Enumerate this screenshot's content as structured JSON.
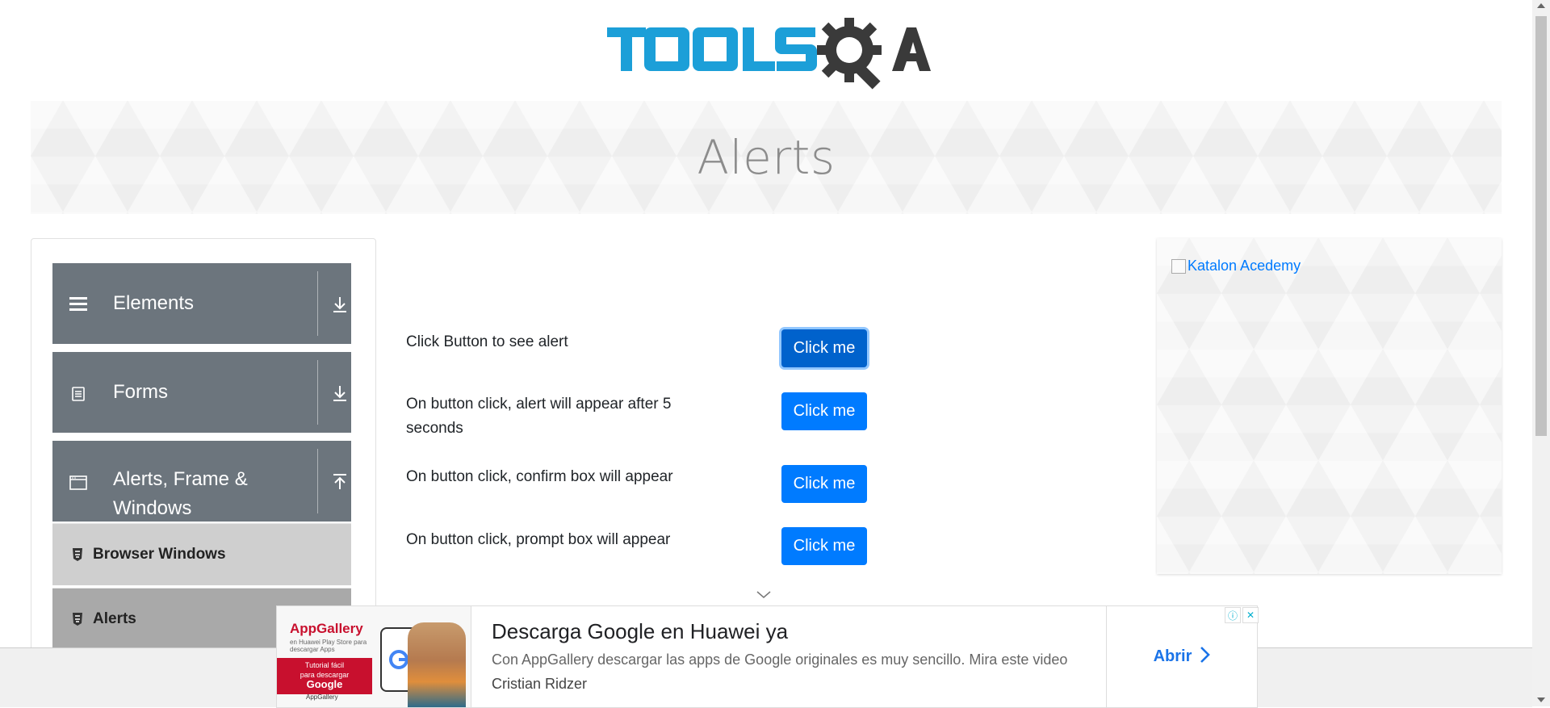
{
  "header": {
    "logo_text": "TOOLSQA"
  },
  "banner": {
    "title": "Alerts"
  },
  "sidebar": {
    "groups": [
      {
        "label": "Elements",
        "icon": "hamburger-icon",
        "state": "collapsed"
      },
      {
        "label": "Forms",
        "icon": "document-icon",
        "state": "collapsed"
      },
      {
        "label": "Alerts, Frame & Windows",
        "icon": "window-icon",
        "state": "expanded"
      }
    ],
    "items": [
      {
        "label": "Browser Windows",
        "icon": "html5-icon",
        "active": false
      },
      {
        "label": "Alerts",
        "icon": "html5-icon",
        "active": true
      }
    ]
  },
  "main": {
    "rows": [
      {
        "text": "Click Button to see alert",
        "button": "Click me"
      },
      {
        "text": "On button click, alert will appear after 5 seconds",
        "button": "Click me"
      },
      {
        "text": "On button click, confirm box will appear",
        "button": "Click me"
      },
      {
        "text": "On button click, prompt box will appear",
        "button": "Click me"
      }
    ]
  },
  "right_ad": {
    "alt_text": "Katalon Acedemy"
  },
  "bottom_ad": {
    "title": "Descarga Google en Huawei ya",
    "description": "Con AppGallery descargar las apps de Google originales es muy sencillo. Mira este video",
    "advertiser": "Cristian Ridzer",
    "cta": "Abrir",
    "thumb": {
      "brand": "AppGallery",
      "brand_sub": "en Huawei Play Store para descargar Apps",
      "banner_line1": "Tutorial fácil",
      "banner_line2": "para descargar",
      "banner_word": "Google",
      "footer": "AppGallery"
    }
  },
  "colors": {
    "primary": "#007bff",
    "sidebar_group": "#6c757d",
    "sub_item": "#cfcfcf",
    "sub_item_active": "#a9a9a9",
    "logo_blue": "#1c9fd8",
    "logo_dark": "#3a3a3a"
  }
}
